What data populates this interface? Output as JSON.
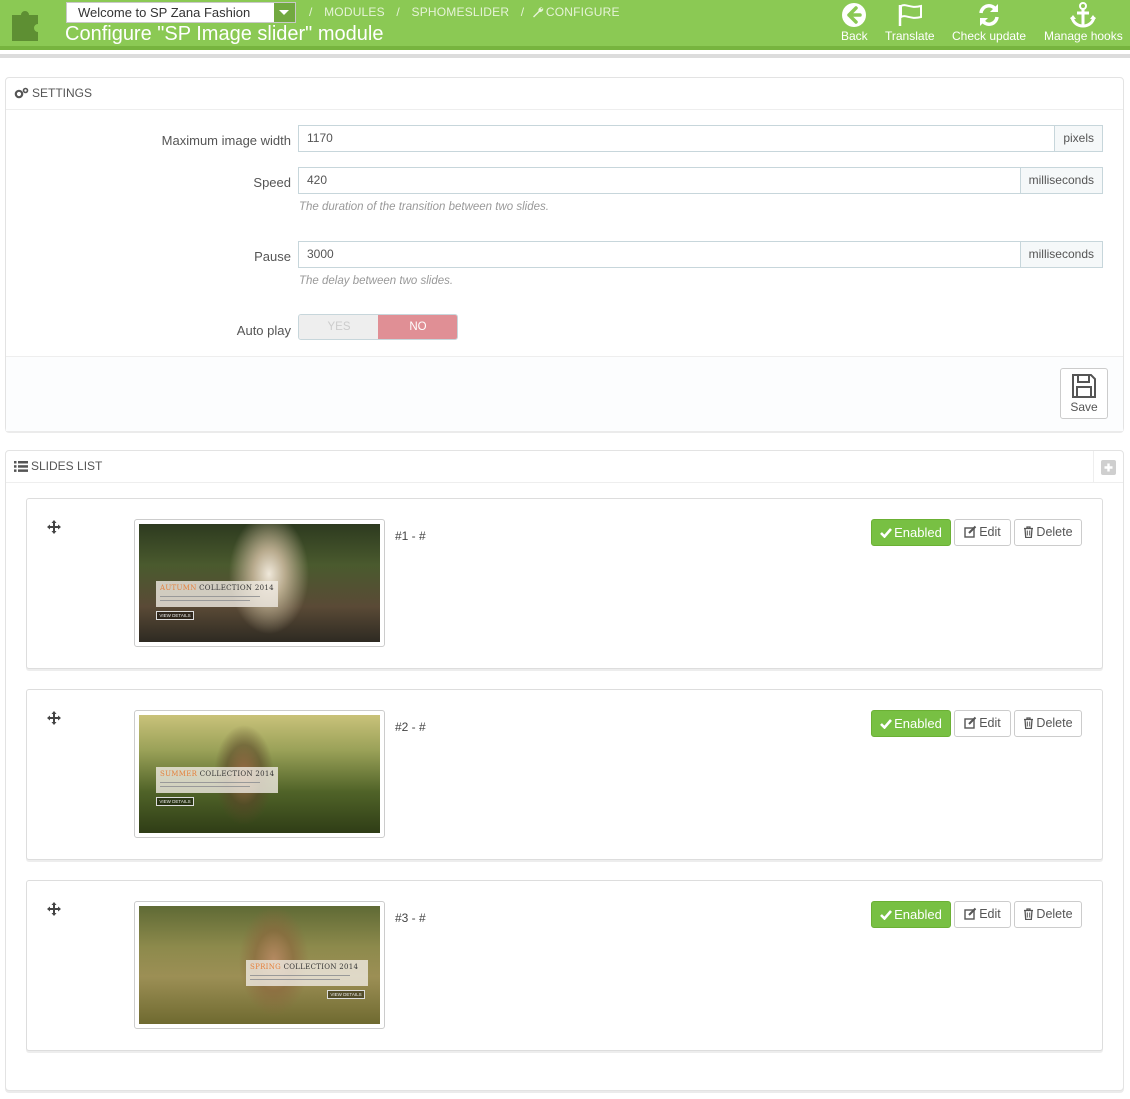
{
  "header": {
    "shop_selector": "Welcome to SP Zana Fashion",
    "breadcrumb": [
      "MODULES",
      "SPHOMESLIDER",
      "CONFIGURE"
    ],
    "title": "Configure \"SP Image slider\" module",
    "toolbar": {
      "back": "Back",
      "translate": "Translate",
      "check_update": "Check update",
      "manage_hooks": "Manage hooks"
    }
  },
  "settings": {
    "heading": "SETTINGS",
    "fields": {
      "max_width": {
        "label": "Maximum image width",
        "value": "1170",
        "unit": "pixels"
      },
      "speed": {
        "label": "Speed",
        "value": "420",
        "unit": "milliseconds",
        "help": "The duration of the transition between two slides."
      },
      "pause": {
        "label": "Pause",
        "value": "3000",
        "unit": "milliseconds",
        "help": "The delay between two slides."
      },
      "autoplay": {
        "label": "Auto play",
        "yes": "YES",
        "no": "NO",
        "selected": "NO"
      }
    },
    "save_label": "Save"
  },
  "slides_list": {
    "heading": "SLIDES LIST",
    "slides": [
      {
        "title": "#1 - #",
        "caption_accent": "AUTUMN",
        "caption_rest": " COLLECTION 2014",
        "button": "VIEW DETAILS",
        "status": "Enabled",
        "edit": "Edit",
        "delete": "Delete"
      },
      {
        "title": "#2 - #",
        "caption_accent": "SUMMER",
        "caption_rest": " COLLECTION 2014",
        "button": "VIEW DETAILS",
        "status": "Enabled",
        "edit": "Edit",
        "delete": "Delete"
      },
      {
        "title": "#3 - #",
        "caption_accent": "SPRING",
        "caption_rest": " COLLECTION 2014",
        "button": "VIEW DETAILS",
        "status": "Enabled",
        "edit": "Edit",
        "delete": "Delete"
      }
    ]
  },
  "colors": {
    "header_green": "#8bc954",
    "enabled_green": "#78c043",
    "no_red": "#e08f95"
  }
}
